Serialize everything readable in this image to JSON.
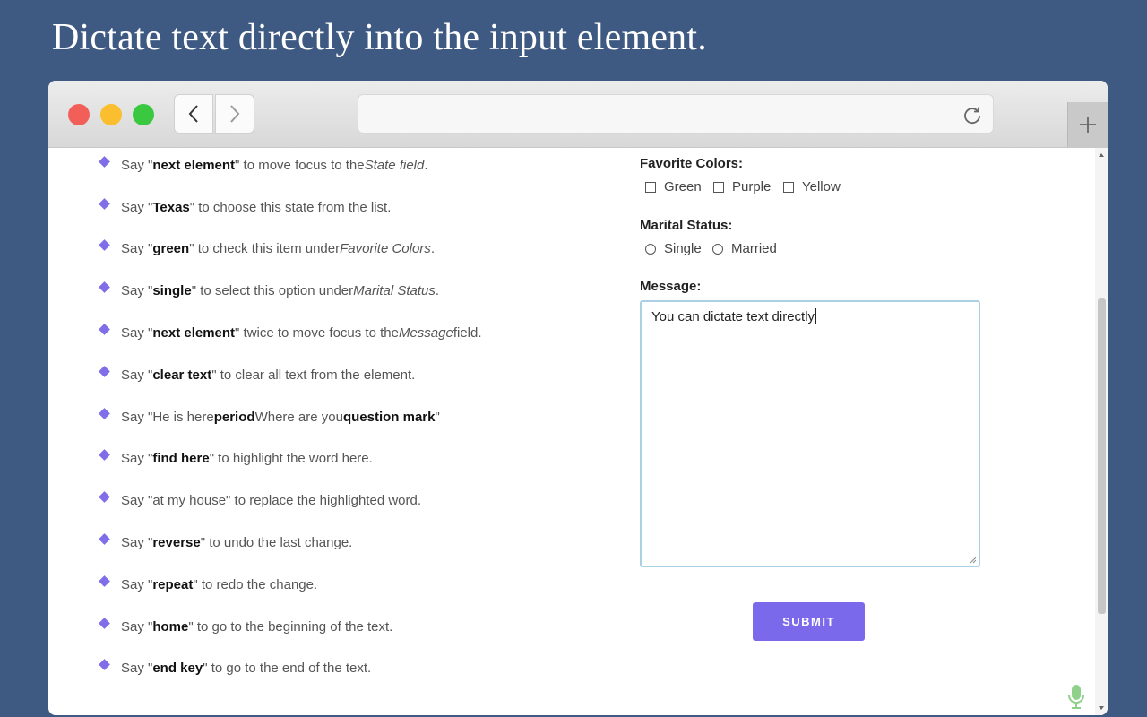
{
  "headline": "Dictate text directly into the input element.",
  "browser": {
    "back_icon": "chevron-left-icon",
    "forward_icon": "chevron-right-icon",
    "reload_icon": "reload-icon",
    "new_tab_icon": "plus-icon",
    "url": ""
  },
  "commands": [
    {
      "pre": "Say \"",
      "bold": "next element",
      "post": "\" to move focus to the ",
      "em": "State field",
      "tail": "."
    },
    {
      "pre": "Say \"",
      "bold": "Texas",
      "post": "\" to choose this state from the list.",
      "em": "",
      "tail": ""
    },
    {
      "pre": "Say \"",
      "bold": "green",
      "post": "\" to check this item under ",
      "em": "Favorite Colors",
      "tail": "."
    },
    {
      "pre": "Say \"",
      "bold": "single",
      "post": "\" to select this option under ",
      "em": "Marital Status",
      "tail": "."
    },
    {
      "pre": "Say \"",
      "bold": "next element",
      "post": "\" twice to move focus to the ",
      "em": "Message",
      "tail": " field."
    },
    {
      "pre": "Say \"",
      "bold": "clear text",
      "post": "\" to clear all text from the element.",
      "em": "",
      "tail": ""
    },
    {
      "pre": "Say \"He is here ",
      "bold": "period",
      "post": " Where are you ",
      "em": "",
      "tail": "",
      "bold2": "question mark",
      "post2": "\""
    },
    {
      "pre": "Say \"",
      "bold": "find here",
      "post": "\" to highlight the word here.",
      "em": "",
      "tail": ""
    },
    {
      "pre": "Say \"at my house\" to replace the highlighted word.",
      "bold": "",
      "post": "",
      "em": "",
      "tail": ""
    },
    {
      "pre": "Say \"",
      "bold": "reverse",
      "post": "\" to undo the last change.",
      "em": "",
      "tail": ""
    },
    {
      "pre": "Say \"",
      "bold": "repeat",
      "post": "\" to redo the change.",
      "em": "",
      "tail": ""
    },
    {
      "pre": "Say \"",
      "bold": "home",
      "post": "\" to go to the beginning of the text.",
      "em": "",
      "tail": ""
    },
    {
      "pre": "Say \"",
      "bold": "end key",
      "post": "\" to go to the end of the text.",
      "em": "",
      "tail": ""
    }
  ],
  "form": {
    "favorite_colors_label": "Favorite Colors:",
    "colors": [
      {
        "label": "Green",
        "checked": false
      },
      {
        "label": "Purple",
        "checked": false
      },
      {
        "label": "Yellow",
        "checked": false
      }
    ],
    "marital_status_label": "Marital Status:",
    "marital": [
      {
        "label": "Single",
        "selected": false
      },
      {
        "label": "Married",
        "selected": false
      }
    ],
    "message_label": "Message:",
    "message_value": "You can dictate text directly",
    "submit_label": "SUBMIT"
  },
  "colors": {
    "background": "#3f5a82",
    "accent": "#7b69ec",
    "bullet": "#7f6ee8",
    "focus_border": "#a9d1e3"
  },
  "mic_icon": "microphone-icon"
}
